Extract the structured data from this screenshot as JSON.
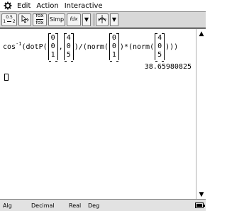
{
  "menubar": {
    "gear_icon": "gear-icon",
    "items": [
      "Edit",
      "Action",
      "Interactive"
    ]
  },
  "toolbar": {
    "btn_settings": {
      "top": "0.5",
      "mid": "1",
      "bottom": "2"
    },
    "btn_cursor_icon": "pointer-arrow-icon",
    "btn_fraction": {
      "top": "fdx",
      "bottom": "fdx"
    },
    "btn_simp": "Simp",
    "btn_integral": "fdx",
    "btn_graph_icon": "graph-icon"
  },
  "work": {
    "prefix": "cos",
    "exponent": "-1",
    "part1": "(dotP(",
    "vecA": [
      "0",
      "0",
      "1"
    ],
    "comma": ",",
    "vecB": [
      "4",
      "0",
      "5"
    ],
    "part2": ")/(norm(",
    "vecC": [
      "0",
      "0",
      "1"
    ],
    "part3": ")*(norm(",
    "vecD": [
      "4",
      "0",
      "5"
    ],
    "part4": ")))",
    "result": "38.65980825"
  },
  "statusbar": {
    "mode1": "Alg",
    "mode2": "Decimal",
    "mode3": "Real",
    "mode4": "Deg",
    "battery_icon": "battery-icon"
  }
}
